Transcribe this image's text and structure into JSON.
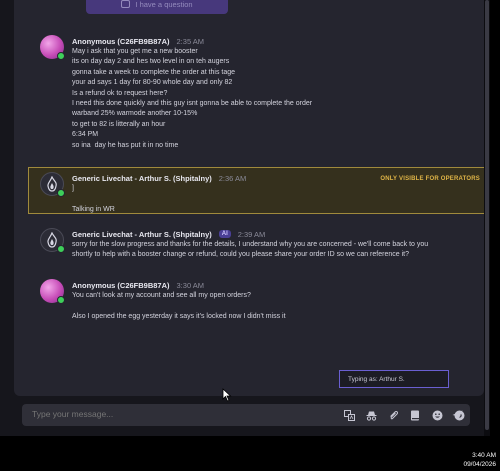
{
  "ask_button": {
    "label": "I have a question"
  },
  "messages": [
    {
      "author": "Anonymous (C26FB9B87A)",
      "time": "2:35 AM",
      "lines": "May i ask that you get me a new booster\nits on day day 2 and hes two level in on teh augers\ngonna take a week to complete the order at this tage\nyour ad says 1 day for 80-90 whole day and only 82\nIs a refund ok to request here?\nI need this done quickly and this guy isnt gonna be able to complete the order\nwarband 25% warmode another 10-15%\nto get to 82 is litterally an hour\n6:34 PM\nso ina  day he has put it in no time"
    },
    {
      "author": "Generic Livechat - Arthur S. (Shpitalny)",
      "time": "2:36 AM",
      "visibility": "ONLY VISIBLE FOR OPERATORS",
      "lines": "]\n\nTalking in WR"
    },
    {
      "author": "Generic Livechat - Arthur S. (Shpitalny)",
      "badge": "AI",
      "time": "2:39 AM",
      "lines": "sorry for the slow progress and thanks for the details, I understand why you are concerned - we'll come back to you\nshortly to help with a booster change or refund, could you please share your order ID so we can reference it?"
    },
    {
      "author": "Anonymous (C26FB9B87A)",
      "time": "3:30 AM",
      "lines": "You can't look at my account and see all my open orders?\n\nAlso I opened the egg yesterday it says it's locked now I didn't miss it"
    }
  ],
  "typing_indicator": "Typing as: Arthur S.",
  "composer": {
    "placeholder": "Type your message...",
    "tools": [
      "translate-icon",
      "incognito-icon",
      "attachment-icon",
      "book-icon",
      "emoji-icon",
      "gif-icon",
      "send-icon"
    ]
  },
  "taskbar": {
    "time": "3:40 AM",
    "date": "09/04/2026"
  },
  "colors": {
    "accent": "#6a5fd1",
    "operator_highlight": "#a08a3c",
    "online": "#3ecf5a"
  }
}
